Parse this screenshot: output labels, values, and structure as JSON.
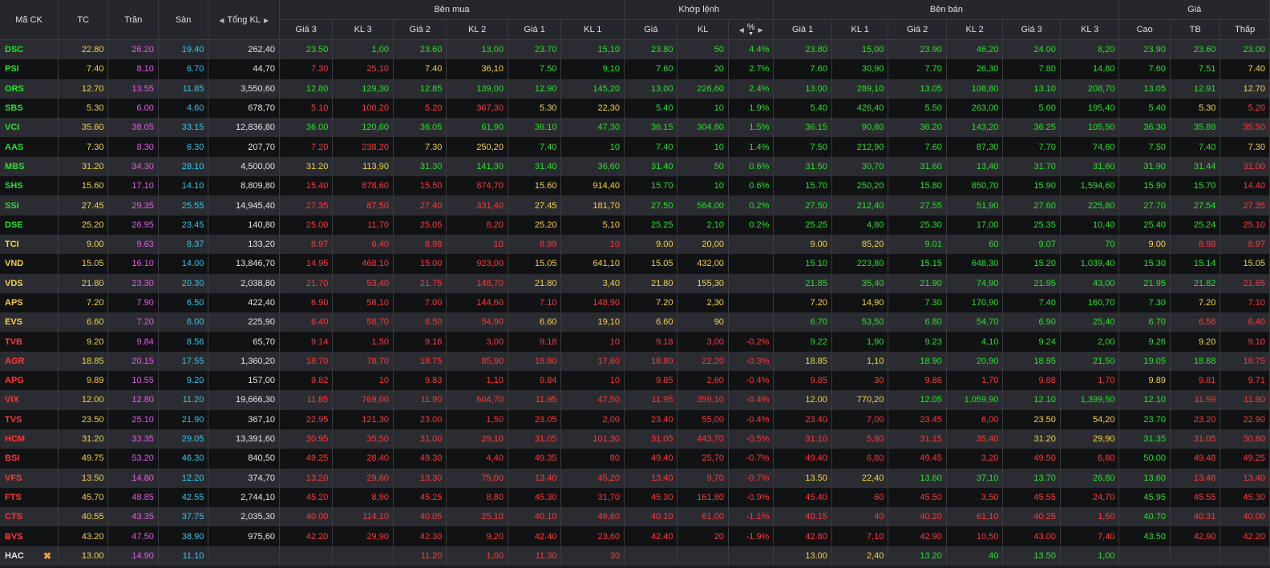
{
  "header": {
    "symbol": "Mã CK",
    "ref": "TC",
    "ceil": "Trần",
    "floor": "Sàn",
    "total_vol": "Tổng KL",
    "buy_group": "Bên mua",
    "match_group": "Khớp lệnh",
    "sell_group": "Bên bán",
    "price_group": "Giá",
    "buy_cols": [
      "Giá 3",
      "KL 3",
      "Giá 2",
      "KL 2",
      "Giá 1",
      "KL 1"
    ],
    "match_cols": [
      "Giá",
      "KL",
      "%"
    ],
    "sell_cols": [
      "Giá 1",
      "KL 1",
      "Giá 2",
      "KL 2",
      "Giá 3",
      "KL 3"
    ],
    "price_cols": [
      "Cao",
      "TB",
      "Thấp"
    ]
  },
  "rows": [
    {
      "s": "DSC",
      "tc": "22.80",
      "ce": "26.20",
      "fl": "19.40",
      "tkl": "262,40",
      "b": [
        "23.50",
        "1,00",
        "23.60",
        "13,00",
        "23.70",
        "15,10"
      ],
      "m": [
        "23.80",
        "50",
        "4.4%"
      ],
      "a": [
        "23.80",
        "15,00",
        "23.90",
        "46,20",
        "24.00",
        "8,20"
      ],
      "h": [
        "23.90",
        "23.60",
        "23.00"
      ]
    },
    {
      "s": "PSI",
      "tc": "7.40",
      "ce": "8.10",
      "fl": "6.70",
      "tkl": "44,70",
      "b": [
        "7.30",
        "25,10",
        "7.40",
        "36,10",
        "7.50",
        "9,10"
      ],
      "m": [
        "7.60",
        "20",
        "2.7%"
      ],
      "a": [
        "7.60",
        "30,90",
        "7.70",
        "26,30",
        "7.80",
        "14,80"
      ],
      "h": [
        "7.60",
        "7.51",
        "7.40"
      ]
    },
    {
      "s": "ORS",
      "tc": "12.70",
      "ce": "13.55",
      "fl": "11.85",
      "tkl": "3,550,60",
      "b": [
        "12.80",
        "129,30",
        "12.85",
        "139,00",
        "12.90",
        "145,20"
      ],
      "m": [
        "13.00",
        "226,60",
        "2.4%"
      ],
      "a": [
        "13.00",
        "289,10",
        "13.05",
        "108,80",
        "13.10",
        "208,70"
      ],
      "h": [
        "13.05",
        "12.91",
        "12.70"
      ]
    },
    {
      "s": "SBS",
      "tc": "5.30",
      "ce": "6.00",
      "fl": "4.60",
      "tkl": "678,70",
      "b": [
        "5.10",
        "100,20",
        "5.20",
        "367,30",
        "5.30",
        "22,30"
      ],
      "m": [
        "5.40",
        "10",
        "1.9%"
      ],
      "a": [
        "5.40",
        "426,40",
        "5.50",
        "263,00",
        "5.60",
        "195,40"
      ],
      "h": [
        "5.40",
        "5.30",
        "5.20"
      ]
    },
    {
      "s": "VCI",
      "tc": "35.60",
      "ce": "38.05",
      "fl": "33.15",
      "tkl": "12,836,80",
      "b": [
        "36.00",
        "120,60",
        "36.05",
        "61,90",
        "36.10",
        "47,30"
      ],
      "m": [
        "36.15",
        "304,80",
        "1.5%"
      ],
      "a": [
        "36.15",
        "90,80",
        "36.20",
        "143,20",
        "36.25",
        "105,50"
      ],
      "h": [
        "36.30",
        "35.89",
        "35.50"
      ]
    },
    {
      "s": "AAS",
      "tc": "7.30",
      "ce": "8.30",
      "fl": "6.30",
      "tkl": "207,70",
      "b": [
        "7.20",
        "238,20",
        "7.30",
        "250,20",
        "7.40",
        "10"
      ],
      "m": [
        "7.40",
        "10",
        "1.4%"
      ],
      "a": [
        "7.50",
        "212,90",
        "7.60",
        "87,30",
        "7.70",
        "74,60"
      ],
      "h": [
        "7.50",
        "7.40",
        "7.30"
      ]
    },
    {
      "s": "MBS",
      "tc": "31.20",
      "ce": "34.30",
      "fl": "28.10",
      "tkl": "4,500,00",
      "b": [
        "31.20",
        "113,90",
        "31.30",
        "141,30",
        "31.40",
        "36,60"
      ],
      "m": [
        "31.40",
        "50",
        "0.6%"
      ],
      "a": [
        "31.50",
        "30,70",
        "31.60",
        "13,40",
        "31.70",
        "31,60"
      ],
      "h": [
        "31.90",
        "31.44",
        "31.00"
      ]
    },
    {
      "s": "SHS",
      "tc": "15.60",
      "ce": "17.10",
      "fl": "14.10",
      "tkl": "8,809,80",
      "b": [
        "15.40",
        "878,60",
        "15.50",
        "874,70",
        "15.60",
        "914,40"
      ],
      "m": [
        "15.70",
        "10",
        "0.6%"
      ],
      "a": [
        "15.70",
        "250,20",
        "15.80",
        "850,70",
        "15.90",
        "1,594,60"
      ],
      "h": [
        "15.90",
        "15.70",
        "14.40"
      ]
    },
    {
      "s": "SSI",
      "tc": "27.45",
      "ce": "29.35",
      "fl": "25.55",
      "tkl": "14,945,40",
      "b": [
        "27.35",
        "87,50",
        "27.40",
        "331,40",
        "27.45",
        "181,70"
      ],
      "m": [
        "27.50",
        "564,00",
        "0.2%"
      ],
      "a": [
        "27.50",
        "212,40",
        "27.55",
        "51,90",
        "27.60",
        "225,80"
      ],
      "h": [
        "27.70",
        "27.54",
        "27.35"
      ]
    },
    {
      "s": "DSE",
      "tc": "25.20",
      "ce": "26.95",
      "fl": "23.45",
      "tkl": "140,80",
      "b": [
        "25.00",
        "11,70",
        "25.05",
        "8,20",
        "25.20",
        "5,10"
      ],
      "m": [
        "25.25",
        "2,10",
        "0.2%"
      ],
      "a": [
        "25.25",
        "4,80",
        "25.30",
        "17,00",
        "25.35",
        "10,40"
      ],
      "h": [
        "25.40",
        "25.24",
        "25.10"
      ]
    },
    {
      "s": "TCI",
      "tc": "9.00",
      "ce": "9.63",
      "fl": "8.37",
      "tkl": "133,20",
      "b": [
        "8.97",
        "6,40",
        "8.98",
        "10",
        "8.99",
        "10"
      ],
      "m": [
        "9.00",
        "20,00",
        ""
      ],
      "a": [
        "9.00",
        "85,20",
        "9.01",
        "60",
        "9.07",
        "70"
      ],
      "h": [
        "9.00",
        "8.98",
        "8.97"
      ]
    },
    {
      "s": "VND",
      "tc": "15.05",
      "ce": "16.10",
      "fl": "14.00",
      "tkl": "13,846,70",
      "b": [
        "14.95",
        "468,10",
        "15.00",
        "923,00",
        "15.05",
        "641,10"
      ],
      "m": [
        "15.05",
        "432,00",
        ""
      ],
      "a": [
        "15.10",
        "223,80",
        "15.15",
        "648,30",
        "15.20",
        "1,039,40"
      ],
      "h": [
        "15.30",
        "15.14",
        "15.05"
      ]
    },
    {
      "s": "VDS",
      "tc": "21.80",
      "ce": "23.30",
      "fl": "20.30",
      "tkl": "2,038,80",
      "b": [
        "21.70",
        "53,40",
        "21.75",
        "148,70",
        "21.80",
        "3,40"
      ],
      "m": [
        "21.80",
        "155,30",
        ""
      ],
      "a": [
        "21.85",
        "35,40",
        "21.90",
        "74,90",
        "21.95",
        "43,00"
      ],
      "h": [
        "21.95",
        "21.82",
        "21.65"
      ]
    },
    {
      "s": "APS",
      "tc": "7.20",
      "ce": "7.90",
      "fl": "6.50",
      "tkl": "422,40",
      "b": [
        "6.90",
        "58,10",
        "7.00",
        "144,60",
        "7.10",
        "148,90"
      ],
      "m": [
        "7.20",
        "2,30",
        ""
      ],
      "a": [
        "7.20",
        "14,90",
        "7.30",
        "170,90",
        "7.40",
        "160,70"
      ],
      "h": [
        "7.30",
        "7.20",
        "7.10"
      ]
    },
    {
      "s": "EVS",
      "tc": "6.60",
      "ce": "7.20",
      "fl": "6.00",
      "tkl": "225,90",
      "b": [
        "6.40",
        "58,70",
        "6.50",
        "54,90",
        "6.60",
        "19,10"
      ],
      "m": [
        "6.60",
        "90",
        ""
      ],
      "a": [
        "6.70",
        "53,50",
        "6.80",
        "54,70",
        "6.90",
        "25,40"
      ],
      "h": [
        "6.70",
        "6.56",
        "6.40"
      ]
    },
    {
      "s": "TVB",
      "tc": "9.20",
      "ce": "9.84",
      "fl": "8.56",
      "tkl": "65,70",
      "b": [
        "9.14",
        "1,50",
        "9.16",
        "3,00",
        "9.18",
        "10"
      ],
      "m": [
        "9.18",
        "3,00",
        "-0.2%"
      ],
      "a": [
        "9.22",
        "1,90",
        "9.23",
        "4,10",
        "9.24",
        "2,00"
      ],
      "h": [
        "9.26",
        "9.20",
        "9.10"
      ]
    },
    {
      "s": "AGR",
      "tc": "18.85",
      "ce": "20.15",
      "fl": "17.55",
      "tkl": "1,360,20",
      "b": [
        "18.70",
        "78,70",
        "18.75",
        "85,90",
        "18.80",
        "17,60"
      ],
      "m": [
        "18.80",
        "22,20",
        "-0.3%"
      ],
      "a": [
        "18.85",
        "1,10",
        "18.90",
        "20,90",
        "18.95",
        "21,50"
      ],
      "h": [
        "19.05",
        "18.88",
        "18.75"
      ]
    },
    {
      "s": "APG",
      "tc": "9.89",
      "ce": "10.55",
      "fl": "9.20",
      "tkl": "157,00",
      "b": [
        "9.82",
        "10",
        "9.83",
        "1,10",
        "9.84",
        "10"
      ],
      "m": [
        "9.85",
        "2,60",
        "-0.4%"
      ],
      "a": [
        "9.85",
        "30",
        "9.86",
        "1,70",
        "9.88",
        "1,70"
      ],
      "h": [
        "9.89",
        "9.81",
        "9.71"
      ]
    },
    {
      "s": "VIX",
      "tc": "12.00",
      "ce": "12.80",
      "fl": "11.20",
      "tkl": "19,666,30",
      "b": [
        "11.85",
        "769,00",
        "11.90",
        "604,70",
        "11.95",
        "47,50"
      ],
      "m": [
        "11.95",
        "359,10",
        "-0.4%"
      ],
      "a": [
        "12.00",
        "770,20",
        "12.05",
        "1,059,90",
        "12.10",
        "1,399,50"
      ],
      "h": [
        "12.10",
        "11.99",
        "11.90"
      ]
    },
    {
      "s": "TVS",
      "tc": "23.50",
      "ce": "25.10",
      "fl": "21.90",
      "tkl": "367,10",
      "b": [
        "22.95",
        "121,30",
        "23.00",
        "1,50",
        "23.05",
        "2,00"
      ],
      "m": [
        "23.40",
        "55,00",
        "-0.4%"
      ],
      "a": [
        "23.40",
        "7,00",
        "23.45",
        "6,00",
        "23.50",
        "54,20"
      ],
      "h": [
        "23.70",
        "23.20",
        "22.90"
      ]
    },
    {
      "s": "HCM",
      "tc": "31.20",
      "ce": "33.35",
      "fl": "29.05",
      "tkl": "13,391,60",
      "b": [
        "30.95",
        "35,50",
        "31.00",
        "29,10",
        "31.05",
        "101,30"
      ],
      "m": [
        "31.05",
        "443,70",
        "-0.5%"
      ],
      "a": [
        "31.10",
        "5,80",
        "31.15",
        "35,40",
        "31.20",
        "29,90"
      ],
      "h": [
        "31.35",
        "31.05",
        "30.80"
      ]
    },
    {
      "s": "BSI",
      "tc": "49.75",
      "ce": "53.20",
      "fl": "46.30",
      "tkl": "840,50",
      "b": [
        "49.25",
        "28,40",
        "49.30",
        "4,40",
        "49.35",
        "80"
      ],
      "m": [
        "49.40",
        "25,70",
        "-0.7%"
      ],
      "a": [
        "49.40",
        "6,80",
        "49.45",
        "3,20",
        "49.50",
        "6,80"
      ],
      "h": [
        "50.00",
        "49.48",
        "49.25"
      ]
    },
    {
      "s": "VFS",
      "tc": "13.50",
      "ce": "14.80",
      "fl": "12.20",
      "tkl": "374,70",
      "b": [
        "13.20",
        "29,60",
        "13.30",
        "75,00",
        "13.40",
        "45,20"
      ],
      "m": [
        "13.40",
        "9,70",
        "-0.7%"
      ],
      "a": [
        "13.50",
        "22,40",
        "13.60",
        "37,10",
        "13.70",
        "26,80"
      ],
      "h": [
        "13.60",
        "13.46",
        "13.40"
      ]
    },
    {
      "s": "FTS",
      "tc": "45.70",
      "ce": "48.85",
      "fl": "42.55",
      "tkl": "2,744,10",
      "b": [
        "45.20",
        "8,90",
        "45.25",
        "8,80",
        "45.30",
        "31,70"
      ],
      "m": [
        "45.30",
        "161,80",
        "-0.9%"
      ],
      "a": [
        "45.40",
        "60",
        "45.50",
        "3,50",
        "45.55",
        "24,70"
      ],
      "h": [
        "45.95",
        "45.55",
        "45.30"
      ]
    },
    {
      "s": "CTS",
      "tc": "40.55",
      "ce": "43.35",
      "fl": "37.75",
      "tkl": "2,035,30",
      "b": [
        "40.00",
        "114,10",
        "40.05",
        "25,10",
        "40.10",
        "46,60"
      ],
      "m": [
        "40.10",
        "61,00",
        "-1.1%"
      ],
      "a": [
        "40.15",
        "40",
        "40.20",
        "61,10",
        "40.25",
        "1,50"
      ],
      "h": [
        "40.70",
        "40.31",
        "40.00"
      ]
    },
    {
      "s": "BVS",
      "tc": "43.20",
      "ce": "47.50",
      "fl": "38.90",
      "tkl": "975,60",
      "b": [
        "42.20",
        "29,90",
        "42.30",
        "9,20",
        "42.40",
        "23,60"
      ],
      "m": [
        "42.40",
        "20",
        "-1.9%"
      ],
      "a": [
        "42.80",
        "7,10",
        "42.90",
        "10,50",
        "43.00",
        "7,40"
      ],
      "h": [
        "43.50",
        "42.90",
        "42.20"
      ]
    },
    {
      "s": "HAC",
      "tc": "13.00",
      "ce": "14.90",
      "fl": "11.10",
      "tkl": "",
      "b": [
        "",
        "",
        "11.20",
        "1,00",
        "11.30",
        "30"
      ],
      "m": [
        "",
        "",
        ""
      ],
      "a": [
        "13.00",
        "2,40",
        "13.20",
        "40",
        "13.50",
        "1,00"
      ],
      "h": [
        "",
        "",
        ""
      ],
      "flag": "✖"
    }
  ]
}
